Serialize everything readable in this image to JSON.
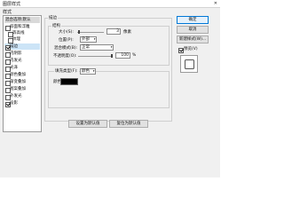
{
  "window": {
    "title": "图层样式",
    "close": "✕"
  },
  "sidebar": {
    "title": "样式",
    "items": [
      {
        "label": "混合选项:默认",
        "checkbox": false,
        "checked": false,
        "selected": false
      },
      {
        "label": "斜面和浮雕",
        "checkbox": true,
        "checked": false,
        "selected": false
      },
      {
        "label": "等高线",
        "checkbox": true,
        "checked": false,
        "selected": false
      },
      {
        "label": "纹理",
        "checkbox": true,
        "checked": false,
        "selected": false
      },
      {
        "label": "描边",
        "checkbox": true,
        "checked": true,
        "selected": true
      },
      {
        "label": "内阴影",
        "checkbox": true,
        "checked": false,
        "selected": false
      },
      {
        "label": "内发光",
        "checkbox": true,
        "checked": false,
        "selected": false
      },
      {
        "label": "光泽",
        "checkbox": true,
        "checked": false,
        "selected": false
      },
      {
        "label": "颜色叠加",
        "checkbox": true,
        "checked": false,
        "selected": false
      },
      {
        "label": "渐变叠加",
        "checkbox": true,
        "checked": false,
        "selected": false
      },
      {
        "label": "图案叠加",
        "checkbox": true,
        "checked": false,
        "selected": false
      },
      {
        "label": "外发光",
        "checkbox": true,
        "checked": false,
        "selected": false
      },
      {
        "label": "投影",
        "checkbox": true,
        "checked": true,
        "selected": false
      }
    ]
  },
  "stroke": {
    "group_title": "描边",
    "structure_title": "结构",
    "size_label": "大小(S):",
    "size_value": "3",
    "size_unit": "像素",
    "position_label": "位置(P):",
    "position_value": "外部",
    "blend_label": "混合模式(B):",
    "blend_value": "正常",
    "opacity_label": "不透明度(O):",
    "opacity_value": "100",
    "opacity_unit": "%",
    "fill_type_label": "填充类型(F):",
    "fill_type_value": "颜色",
    "color_label": "颜色:",
    "color_hex": "#000000"
  },
  "bottom_buttons": {
    "set_default": "设置为默认值",
    "reset_default": "复位为默认值"
  },
  "right_panel": {
    "ok": "确定",
    "cancel": "取消",
    "new_style": "新建样式(W)...",
    "preview_label": "预览(V)",
    "preview_checked": true
  }
}
